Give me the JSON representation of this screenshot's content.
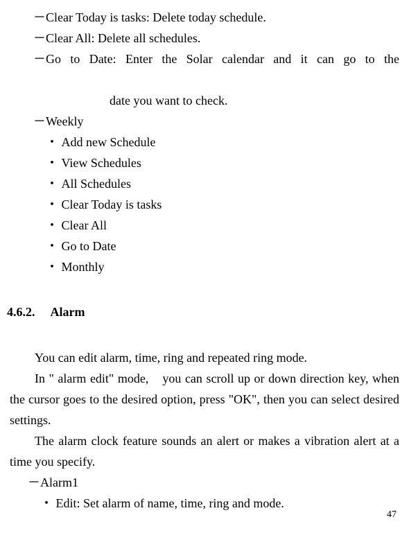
{
  "dashItems": [
    {
      "label": "Clear Today is tasks: Delete today schedule."
    },
    {
      "label": "Clear All: Delete all schedules."
    },
    {
      "label": "Go to Date: Enter the Solar calendar and it can go to the",
      "continuation": "date you want to check."
    },
    {
      "label": "Weekly"
    }
  ],
  "dotItems": [
    "Add new Schedule",
    "View Schedules",
    "All Schedules",
    "Clear Today is tasks",
    "Clear All",
    "Go to Date",
    "Monthly"
  ],
  "section": {
    "number": "4.6.2.",
    "title": "Alarm"
  },
  "paragraphs": [
    "You can edit alarm, time, ring and repeated ring mode.",
    "In \" alarm edit\" mode,　you can scroll up or down direction key, when the cursor goes to the desired option, press \"OK\", then you can select desired settings.",
    "The alarm clock feature sounds an alert or makes a vibration alert at a time you specify."
  ],
  "alarmDash": "Alarm1",
  "alarmDot": "Edit: Set alarm of name, time, ring and mode.",
  "pageNumber": "47",
  "symbols": {
    "dash": "－",
    "dot": "・"
  }
}
